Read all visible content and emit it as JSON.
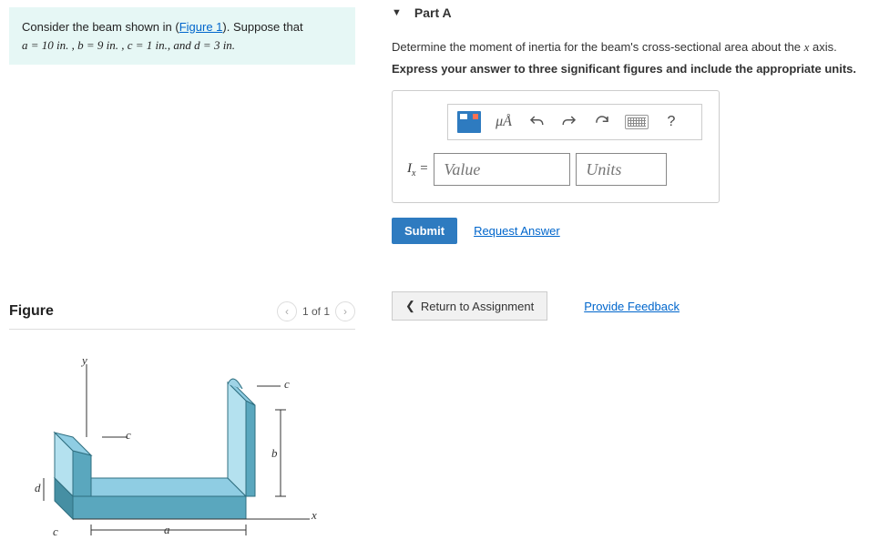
{
  "problem": {
    "text_pre": "Consider the beam shown in (",
    "figure_link": "Figure 1",
    "text_mid": "). Suppose that ",
    "equation_text": "a = 10  in. , b = 9  in. , c = 1 in., and d = 3  in."
  },
  "figure": {
    "title": "Figure",
    "pager": {
      "prev": "‹",
      "label": "1 of 1",
      "next": "›"
    },
    "labels": {
      "y": "y",
      "x": "x",
      "a": "a",
      "b": "b",
      "c": "c",
      "d": "d"
    }
  },
  "part": {
    "caret": "▼",
    "title": "Part A",
    "instruction": "Determine the moment of inertia for the beam's cross-sectional area about the x axis.",
    "bold": "Express your answer to three significant figures and include the appropriate units."
  },
  "answer": {
    "toolbar": {
      "mu_label": "μÅ",
      "help": "?"
    },
    "prefix_html": "I",
    "prefix_sub": "x",
    "equals": " = ",
    "value_placeholder": "Value",
    "units_placeholder": "Units"
  },
  "actions": {
    "submit": "Submit",
    "request_answer": "Request Answer",
    "return": "Return to Assignment",
    "return_chevron": "❮",
    "provide_feedback": "Provide Feedback"
  }
}
